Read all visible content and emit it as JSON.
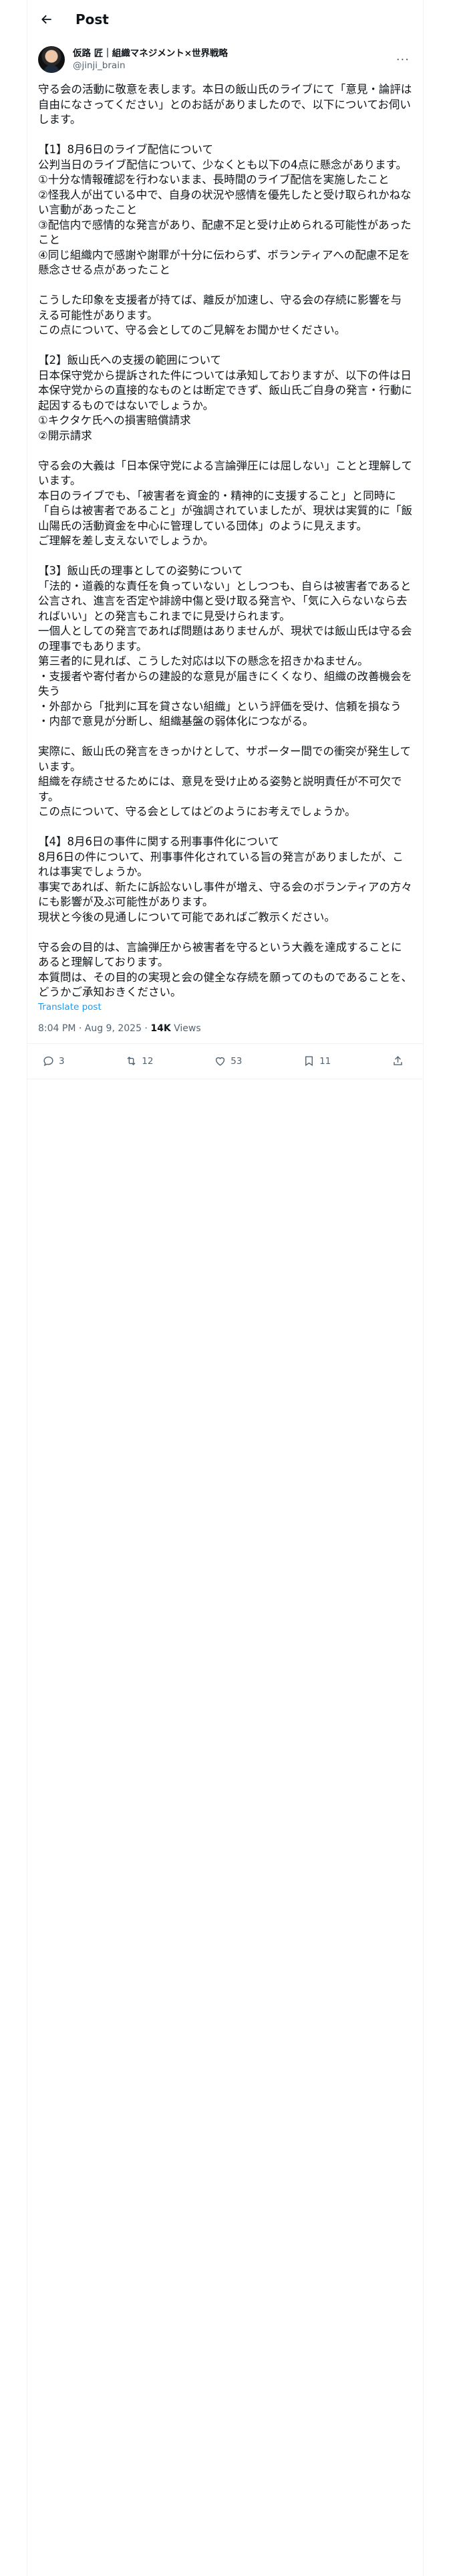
{
  "header": {
    "title": "Post"
  },
  "author": {
    "name": "仮路 匠｜組織マネジメント×世界戦略",
    "handle": "@jinji_brain",
    "more": "···"
  },
  "post": {
    "body": "守る会の活動に敬意を表します。本日の飯山氏のライブにて「意見・論評は自由になさってください」とのお話がありましたので、以下についてお伺いします。\n\n【1】8月6日のライブ配信について\n公判当日のライブ配信について、少なくとも以下の4点に懸念があります。\n①十分な情報確認を行わないまま、長時間のライブ配信を実施したこと\n②怪我人が出ている中で、自身の状況や感情を優先したと受け取られかねない言動があったこと\n③配信内で感情的な発言があり、配慮不足と受け止められる可能性があったこと\n④同じ組織内で感謝や謝罪が十分に伝わらず、ボランティアへの配慮不足を懸念させる点があったこと\n\nこうした印象を支援者が持てば、離反が加速し、守る会の存続に影響を与える可能性があります。\nこの点について、守る会としてのご見解をお聞かせください。\n\n【2】飯山氏への支援の範囲について\n日本保守党から提訴された件については承知しておりますが、以下の件は日本保守党からの直接的なものとは断定できず、飯山氏ご自身の発言・行動に起因するものではないでしょうか。\n①キクタケ氏への損害賠償請求\n②開示請求\n\n守る会の大義は「日本保守党による言論弾圧には屈しない」ことと理解しています。\n本日のライブでも、「被害者を資金的・精神的に支援すること」と同時に「自らは被害者であること」が強調されていましたが、現状は実質的に「飯山陽氏の活動資金を中心に管理している団体」のように見えます。\nご理解を差し支えないでしょうか。\n\n【3】飯山氏の理事としての姿勢について\n「法的・道義的な責任を負っていない」としつつも、自らは被害者であると公言され、進言を否定や誹謗中傷と受け取る発言や、「気に入らないなら去ればいい」との発言もこれまでに見受けられます。\n一個人としての発言であれば問題はありませんが、現状では飯山氏は守る会の理事でもあります。\n第三者的に見れば、こうした対応は以下の懸念を招きかねません。\n・支援者や寄付者からの建設的な意見が届きにくくなり、組織の改善機会を失う\n・外部から「批判に耳を貸さない組織」という評価を受け、信頼を損なう\n・内部で意見が分断し、組織基盤の弱体化につながる。\n\n実際に、飯山氏の発言をきっかけとして、サポーター間での衝突が発生しています。\n組織を存続させるためには、意見を受け止める姿勢と説明責任が不可欠です。\nこの点について、守る会としてはどのようにお考えでしょうか。\n\n【4】8月6日の事件に関する刑事事件化について\n8月6日の件について、刑事事件化されている旨の発言がありましたが、これは事実でしょうか。\n事実であれば、新たに訴訟ないし事件が増え、守る会のボランティアの方々にも影響が及ぶ可能性があります。\n現状と今後の見通しについて可能であればご教示ください。\n\n守る会の目的は、言論弾圧から被害者を守るという大義を達成することにあると理解しております。\n本質問は、その目的の実現と会の健全な存続を願ってのものであることを、どうかご承知おきください。",
    "translate_label": "Translate post"
  },
  "meta": {
    "time": "8:04 PM · Aug 9, 2025",
    "separator": " · ",
    "views_count": "14K",
    "views_label": " Views"
  },
  "actions": {
    "replies": "3",
    "reposts": "12",
    "likes": "53",
    "bookmarks": "11"
  }
}
